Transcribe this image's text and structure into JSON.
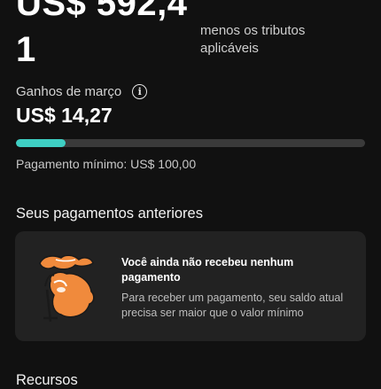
{
  "balance": {
    "amount_text": "US$ 592,4\n1",
    "tax_note": "menos os tributos aplicáveis"
  },
  "monthly": {
    "label": "Ganhos de março",
    "info_icon": "info-icon",
    "amount": "US$ 14,27",
    "progress_fraction": 0.1427,
    "min_payment": "Pagamento mínimo: US$ 100,00"
  },
  "past_payments": {
    "title": "Seus pagamentos anteriores",
    "empty_state": {
      "illustration": "empty-payments-illustration",
      "title": "Você ainda não recebeu nenhum pagamento",
      "description": "Para receber um pagamento, seu saldo atual precisa ser maior que o valor mínimo"
    }
  },
  "resources": {
    "title": "Recursos"
  },
  "colors": {
    "background": "#111111",
    "card": "#222222",
    "progress_fill": "#3ecfc3",
    "progress_track": "#3a3a3a",
    "illustration_orange": "#f08a3c"
  }
}
